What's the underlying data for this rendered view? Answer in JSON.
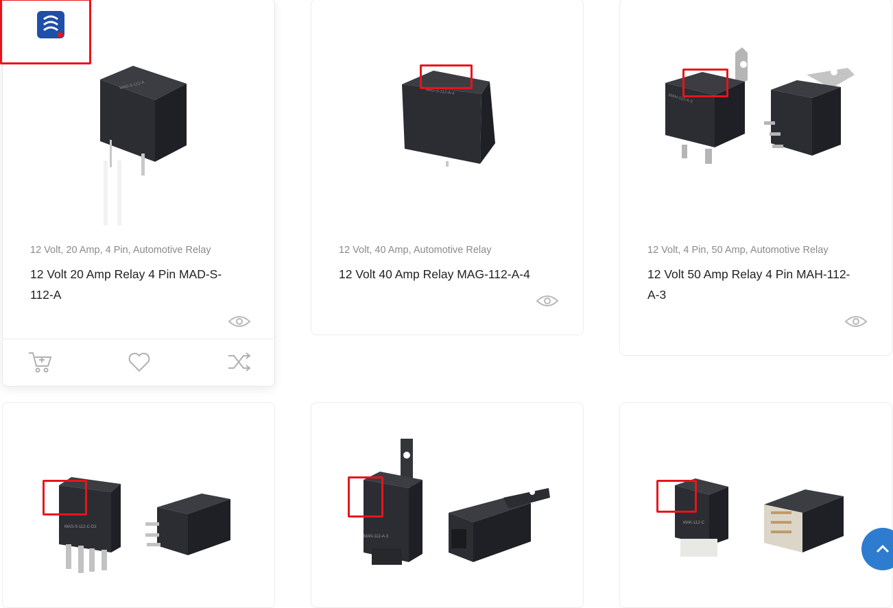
{
  "products": [
    {
      "categories": "12 Volt, 20 Amp, 4 Pin, Automotive Relay",
      "title": "12 Volt 20 Amp Relay 4 Pin MAD-S-112-A",
      "image_text": "MAD-S-112-A"
    },
    {
      "categories": "12 Volt, 40 Amp, Automotive Relay",
      "title": "12 Volt 40 Amp Relay MAG-112-A-4",
      "image_text": "MAG-S-112-A-4"
    },
    {
      "categories": "12 Volt, 4 Pin, 50 Amp, Automotive Relay",
      "title": "12 Volt 50 Amp Relay 4 Pin MAH-112-A-3",
      "image_text": "MAH-112-A-3"
    },
    {
      "categories": "",
      "title": "",
      "image_text": "MAS-S-112-C-D2"
    },
    {
      "categories": "",
      "title": "",
      "image_text": "MAN-112-A-3"
    },
    {
      "categories": "",
      "title": "",
      "image_text": "MAK-112-C"
    }
  ],
  "colors": {
    "highlight": "#e8141b",
    "accent": "#2e7cd0",
    "relay_body": "#2b2d32",
    "brand": "#1f4fa8"
  },
  "icons": {
    "view": "eye-icon",
    "cart": "cart-icon",
    "wishlist": "heart-icon",
    "compare": "shuffle-icon",
    "scroll_top": "chevron-up-icon"
  }
}
